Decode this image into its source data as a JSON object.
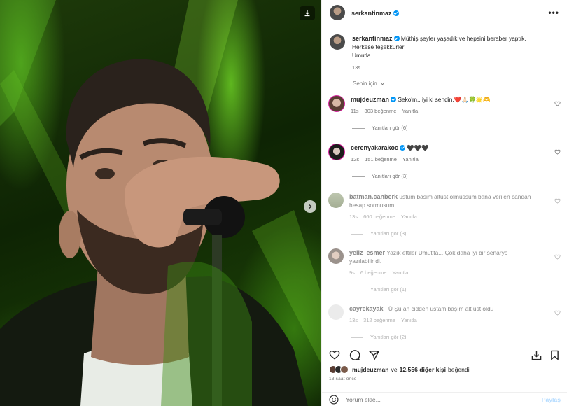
{
  "post": {
    "author": "serkantinmaz",
    "more_label": "•••"
  },
  "caption": {
    "username": "serkantinmaz",
    "line1": "Müthiş şeyler yaşadık ve hepsini beraber yaptık.",
    "line2": "Herkese teşekkürler",
    "line3": "Umutla.",
    "time": "13s"
  },
  "sort_label": "Senin için",
  "comments": [
    {
      "username": "mujdeuzman",
      "verified": true,
      "text": "Seko'm.. iyi ki sendin.❤️🙏🏻🍀🌟🫶",
      "time": "11s",
      "likes": "303 beğenme",
      "reply": "Yanıtla",
      "view_replies": "Yanıtları gör (6)"
    },
    {
      "username": "cerenyakarakoc",
      "verified": true,
      "text": "🖤🖤🖤",
      "time": "12s",
      "likes": "151 beğenme",
      "reply": "Yanıtla",
      "view_replies": "Yanıtları gör (3)"
    },
    {
      "username": "batman.canberk",
      "verified": false,
      "text": "ustum basim altust olmussum bana verilen candan hesap sormusum",
      "time": "13s",
      "likes": "660 beğenme",
      "reply": "Yanıtla",
      "view_replies": "Yanıtları gör (3)"
    },
    {
      "username": "yeliz_esmer",
      "verified": false,
      "text": "Yazık ettiler Umut'ta... Çok daha iyi bir senaryo yazılabilir di.",
      "time": "9s",
      "likes": "6 beğenme",
      "reply": "Yanıtla",
      "view_replies": "Yanıtları gör (1)"
    },
    {
      "username": "cayrekayak_",
      "verified": false,
      "text": "Ü Şu an cidden ustam başım alt üst oldu",
      "time": "13s",
      "likes": "312 beğenme",
      "reply": "Yanıtla",
      "view_replies": "Yanıtları gör (2)"
    }
  ],
  "likes": {
    "first": "mujdeuzman",
    "connector": "ve",
    "others": "12.556 diğer kişi",
    "suffix": "beğendi"
  },
  "timeago": "13 saat önce",
  "add_comment": {
    "placeholder": "Yorum ekle...",
    "post_label": "Paylaş"
  },
  "colors": {
    "accent": "#0095f6",
    "like_red": "#ed4956",
    "post_disabled": "#b3dbff"
  }
}
